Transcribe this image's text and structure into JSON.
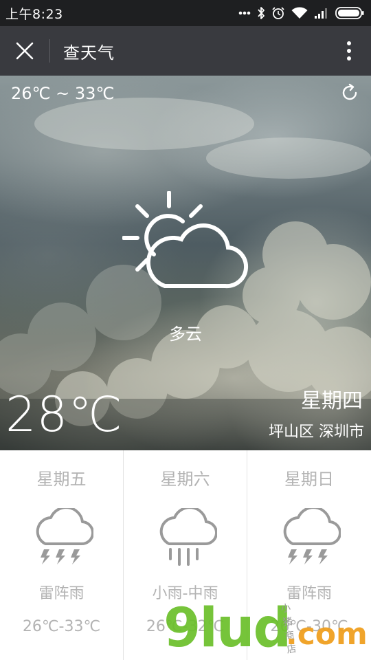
{
  "status_bar": {
    "time": "上午8:23",
    "icons": [
      "dots-icon",
      "bluetooth-icon",
      "alarm-icon",
      "wifi-icon",
      "signal-icon",
      "battery-icon"
    ]
  },
  "title_bar": {
    "title": "查天气",
    "close_icon": "close-icon",
    "more_icon": "more-vertical-icon"
  },
  "hero": {
    "temp_range": "26℃ ~ 33℃",
    "condition": "多云",
    "condition_icon": "partly-cloudy-icon",
    "current_temp": "28℃",
    "weekday": "星期四",
    "location": "坪山区 深圳市",
    "refresh_icon": "refresh-icon"
  },
  "forecast": [
    {
      "day": "星期五",
      "condition": "雷阵雨",
      "range": "26℃-33℃",
      "icon": "thunderstorm-icon"
    },
    {
      "day": "星期六",
      "condition": "小雨-中雨",
      "range": "26℃-32℃",
      "icon": "rain-icon"
    },
    {
      "day": "星期日",
      "condition": "雷阵雨",
      "range": "26℃-30℃",
      "icon": "thunderstorm-icon"
    }
  ],
  "watermark": {
    "text": "9lud",
    "domain": ".com",
    "sub": "小猪商店"
  },
  "colors": {
    "status_bar": "#1e1f21",
    "title_bar": "#393a3f",
    "forecast_text": "#b3b3b3",
    "watermark_green": "#6bbf2a",
    "watermark_orange": "#f0a020"
  }
}
